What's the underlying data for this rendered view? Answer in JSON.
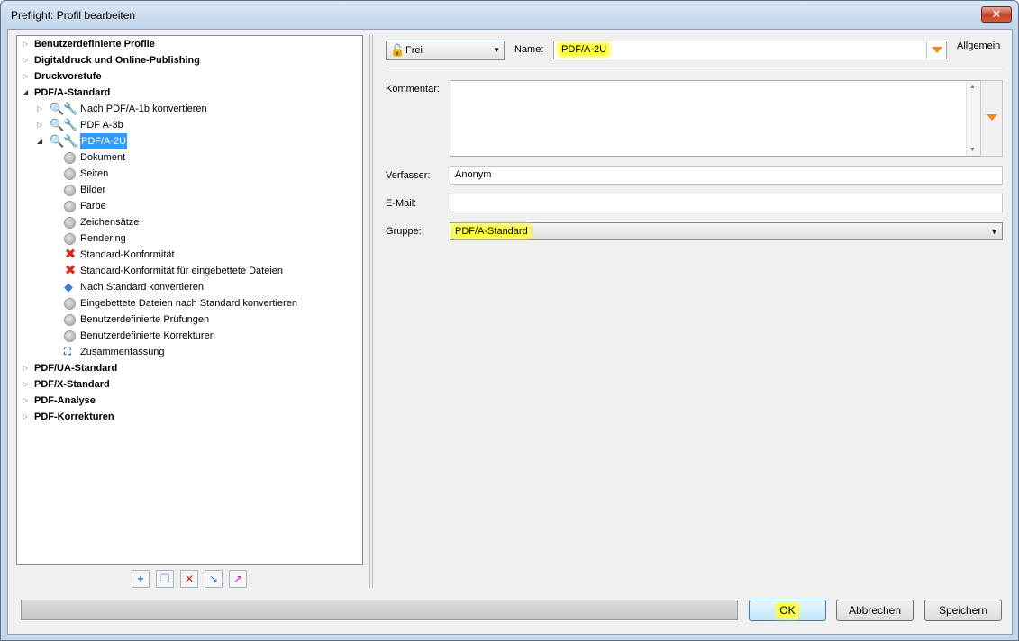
{
  "window": {
    "title": "Preflight: Profil bearbeiten",
    "close_label": "✕"
  },
  "tree": {
    "groups": [
      {
        "label": "Benutzerdefinierte Profile",
        "expanded": false
      },
      {
        "label": "Digitaldruck und Online-Publishing",
        "expanded": false
      },
      {
        "label": "Druckvorstufe",
        "expanded": false
      },
      {
        "label": "PDF/A-Standard",
        "expanded": true
      },
      {
        "label": "PDF/UA-Standard",
        "expanded": false
      },
      {
        "label": "PDF/X-Standard",
        "expanded": false
      },
      {
        "label": "PDF-Analyse",
        "expanded": false
      },
      {
        "label": "PDF-Korrekturen",
        "expanded": false
      }
    ],
    "profiles": [
      {
        "label": "Nach PDF/A-1b konvertieren",
        "selected": false
      },
      {
        "label": "PDF A-3b",
        "selected": false
      },
      {
        "label": "PDF/A-2U",
        "selected": true
      }
    ],
    "sections": [
      {
        "label": "Dokument",
        "icon": "gray-circle-icon"
      },
      {
        "label": "Seiten",
        "icon": "gray-circle-icon"
      },
      {
        "label": "Bilder",
        "icon": "gray-circle-icon"
      },
      {
        "label": "Farbe",
        "icon": "gray-circle-icon"
      },
      {
        "label": "Zeichensätze",
        "icon": "gray-circle-icon"
      },
      {
        "label": "Rendering",
        "icon": "gray-circle-icon"
      },
      {
        "label": "Standard-Konformität",
        "icon": "red-x-icon"
      },
      {
        "label": "Standard-Konformität für eingebettete Dateien",
        "icon": "red-x-icon"
      },
      {
        "label": "Nach Standard konvertieren",
        "icon": "convert-diamond-icon"
      },
      {
        "label": "Eingebettete Dateien nach Standard konvertieren",
        "icon": "gray-circle-icon"
      },
      {
        "label": "Benutzerdefinierte Prüfungen",
        "icon": "gray-circle-icon"
      },
      {
        "label": "Benutzerdefinierte Korrekturen",
        "icon": "gray-circle-icon"
      },
      {
        "label": "Zusammenfassung",
        "icon": "summary-icon"
      }
    ],
    "toolbar": [
      "new-profile-icon",
      "duplicate-icon",
      "delete-icon",
      "import-icon",
      "export-icon"
    ]
  },
  "form": {
    "lock_state": "Frei",
    "name_label": "Name:",
    "name_value": "PDF/A-2U",
    "section_title": "Allgemein",
    "comment_label": "Kommentar:",
    "comment_value": "",
    "author_label": "Verfasser:",
    "author_value": "Anonym",
    "email_label": "E-Mail:",
    "email_value": "",
    "group_label": "Gruppe:",
    "group_value": "PDF/A-Standard"
  },
  "buttons": {
    "ok": "OK",
    "cancel": "Abbrechen",
    "save": "Speichern"
  },
  "colors": {
    "highlight": "#ffff40",
    "selection": "#3399ff",
    "orange_arrow": "#f08a1d",
    "error_x": "#d8261a"
  }
}
